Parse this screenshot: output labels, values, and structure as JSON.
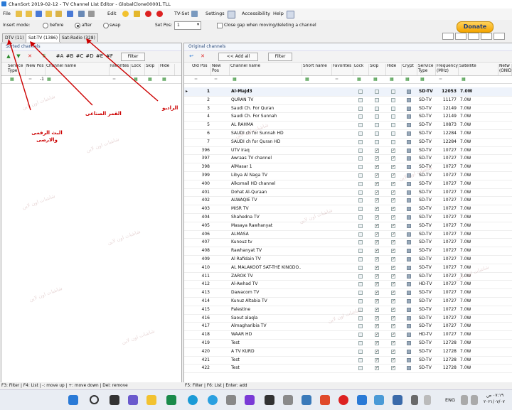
{
  "window": {
    "title": "ChanSort 2019-02-12 - TV Channel List Editor - GlobalClone00001.TLL"
  },
  "menu": {
    "file": "File",
    "edit": "Edit",
    "tvset": "TV-Set",
    "settings": "Settings",
    "accessibility": "Accessibility",
    "help": "Help"
  },
  "options": {
    "insert_mode": "Insert mode:",
    "before": "before",
    "after": "after",
    "swap": "swap",
    "set_pos_label": "Set Pos:",
    "set_pos_value": "1",
    "close_gap": "Close gap when moving/deleting a channel"
  },
  "donate": "Donate",
  "tabs": [
    {
      "label": "DTV (11)"
    },
    {
      "label": "Sat-TV (1386)"
    },
    {
      "label": "Sat-Radio (328)"
    }
  ],
  "left": {
    "title": "Sorted channels",
    "filter": "Filter",
    "btns": [
      "#A",
      "#B",
      "#C",
      "#D",
      "#E",
      "#F"
    ],
    "cols": [
      "Service Type",
      "New Pos",
      "Channel name",
      "Favorites",
      "Lock",
      "Skip",
      "Hide"
    ],
    "filter_pos": "-1"
  },
  "right": {
    "title": "Original channels",
    "add_all": "<< Add all",
    "filter": "Filter",
    "cols": [
      "Old Pos",
      "New Pos",
      "Channel name",
      "Short name",
      "Favorites",
      "Lock",
      "Skip",
      "Hide",
      "Crypt",
      "Service Type",
      "Frequency (MHz)",
      "Satellite",
      "Netw (ONID)"
    ],
    "rows": [
      {
        "old": "1",
        "name": "Al-Majd3",
        "skip": false,
        "hide": false,
        "svc": "SD-TV",
        "freq": "12053",
        "sat": "7.0W",
        "sel": true
      },
      {
        "old": "2",
        "name": "QURAN TV",
        "skip": false,
        "hide": false,
        "svc": "SD-TV",
        "freq": "11177",
        "sat": "7.0W"
      },
      {
        "old": "3",
        "name": "Saudi Ch. For Quran",
        "skip": false,
        "hide": false,
        "svc": "SD-TV",
        "freq": "12149",
        "sat": "7.0W"
      },
      {
        "old": "4",
        "name": "Saudi Ch. For Sunnah",
        "skip": false,
        "hide": false,
        "svc": "SD-TV",
        "freq": "12149",
        "sat": "7.0W"
      },
      {
        "old": "5",
        "name": "AL RAHMA",
        "skip": false,
        "hide": false,
        "svc": "SD-TV",
        "freq": "10873",
        "sat": "7.0W"
      },
      {
        "old": "6",
        "name": "SAUDI ch for Sunnah HD",
        "skip": false,
        "hide": false,
        "svc": "SD-TV",
        "freq": "12284",
        "sat": "7.0W"
      },
      {
        "old": "7",
        "name": "SAUDI ch for Quran HD",
        "skip": false,
        "hide": false,
        "svc": "SD-TV",
        "freq": "12284",
        "sat": "7.0W"
      },
      {
        "old": "396",
        "name": "UTV Iraq",
        "skip": true,
        "hide": true,
        "svc": "SD-TV",
        "freq": "10727",
        "sat": "7.0W"
      },
      {
        "old": "397",
        "name": "Awraas TV channel",
        "skip": true,
        "hide": true,
        "svc": "SD-TV",
        "freq": "10727",
        "sat": "7.0W"
      },
      {
        "old": "398",
        "name": "AlMasar 1",
        "skip": true,
        "hide": true,
        "svc": "SD-TV",
        "freq": "10727",
        "sat": "7.0W"
      },
      {
        "old": "399",
        "name": "Libya Al Naga TV",
        "skip": true,
        "hide": true,
        "svc": "SD-TV",
        "freq": "10727",
        "sat": "7.0W"
      },
      {
        "old": "400",
        "name": "Alkomail HD channel",
        "skip": true,
        "hide": true,
        "svc": "SD-TV",
        "freq": "10727",
        "sat": "7.0W"
      },
      {
        "old": "401",
        "name": "Dohat Al-Quraan",
        "skip": true,
        "hide": true,
        "svc": "SD-TV",
        "freq": "10727",
        "sat": "7.0W"
      },
      {
        "old": "402",
        "name": "ALWAQIE TV",
        "skip": true,
        "hide": true,
        "svc": "SD-TV",
        "freq": "10727",
        "sat": "7.0W"
      },
      {
        "old": "403",
        "name": "MISR TV",
        "skip": true,
        "hide": true,
        "svc": "SD-TV",
        "freq": "10727",
        "sat": "7.0W"
      },
      {
        "old": "404",
        "name": "Shahedna TV",
        "skip": true,
        "hide": true,
        "svc": "SD-TV",
        "freq": "10727",
        "sat": "7.0W"
      },
      {
        "old": "405",
        "name": "Masaya Rawhanyat",
        "skip": true,
        "hide": true,
        "svc": "SD-TV",
        "freq": "10727",
        "sat": "7.0W"
      },
      {
        "old": "406",
        "name": "ALMASA",
        "skip": true,
        "hide": true,
        "svc": "SD-TV",
        "freq": "10727",
        "sat": "7.0W"
      },
      {
        "old": "407",
        "name": "Kunouz tv",
        "skip": true,
        "hide": true,
        "svc": "SD-TV",
        "freq": "10727",
        "sat": "7.0W"
      },
      {
        "old": "408",
        "name": "Rawhanyat TV",
        "skip": true,
        "hide": true,
        "svc": "SD-TV",
        "freq": "10727",
        "sat": "7.0W"
      },
      {
        "old": "409",
        "name": "Al Rafidain TV",
        "skip": true,
        "hide": true,
        "svc": "SD-TV",
        "freq": "10727",
        "sat": "7.0W"
      },
      {
        "old": "410",
        "name": "AL MALAKOOT SAT-THE KINGDO...",
        "skip": true,
        "hide": true,
        "svc": "SD-TV",
        "freq": "10727",
        "sat": "7.0W"
      },
      {
        "old": "411",
        "name": "ZAROK TV",
        "skip": true,
        "hide": true,
        "svc": "SD-TV",
        "freq": "10727",
        "sat": "7.0W"
      },
      {
        "old": "412",
        "name": "Al-Awhad TV",
        "skip": true,
        "hide": true,
        "svc": "HD-TV",
        "freq": "10727",
        "sat": "7.0W"
      },
      {
        "old": "413",
        "name": "Dawacom TV",
        "skip": true,
        "hide": true,
        "svc": "SD-TV",
        "freq": "10727",
        "sat": "7.0W"
      },
      {
        "old": "414",
        "name": "Kunuz Altabia TV",
        "skip": true,
        "hide": true,
        "svc": "SD-TV",
        "freq": "10727",
        "sat": "7.0W"
      },
      {
        "old": "415",
        "name": "Palestine",
        "skip": true,
        "hide": true,
        "svc": "SD-TV",
        "freq": "10727",
        "sat": "7.0W"
      },
      {
        "old": "416",
        "name": "Saout alaqla",
        "skip": true,
        "hide": true,
        "svc": "SD-TV",
        "freq": "10727",
        "sat": "7.0W"
      },
      {
        "old": "417",
        "name": "Almagharibia TV",
        "skip": true,
        "hide": true,
        "svc": "SD-TV",
        "freq": "10727",
        "sat": "7.0W"
      },
      {
        "old": "418",
        "name": "WAAR HD",
        "skip": true,
        "hide": true,
        "svc": "HD-TV",
        "freq": "10727",
        "sat": "7.0W"
      },
      {
        "old": "419",
        "name": "Test",
        "skip": true,
        "hide": true,
        "svc": "SD-TV",
        "freq": "12728",
        "sat": "7.0W"
      },
      {
        "old": "420",
        "name": "A TV KURD",
        "skip": true,
        "hide": true,
        "svc": "SD-TV",
        "freq": "12728",
        "sat": "7.0W"
      },
      {
        "old": "421",
        "name": "Test",
        "skip": true,
        "hide": true,
        "svc": "SD-TV",
        "freq": "12728",
        "sat": "7.0W"
      },
      {
        "old": "422",
        "name": "Test",
        "skip": true,
        "hide": true,
        "svc": "SD-TV",
        "freq": "12728",
        "sat": "7.0W"
      }
    ]
  },
  "annotations": {
    "dtv": "البث الرقمى والارضى",
    "sat_tv": "القمر الصناعى",
    "radio": "الراديو"
  },
  "watermark": "شاشات اون لاين",
  "status": {
    "left": "F3: Filter | F4: List | -: move up | +: move down | Del: remove",
    "right": "F5: Filter | F6: List | Enter: add"
  },
  "taskbar": {
    "lang": "ENG",
    "time": "٠٧:١٩ ص",
    "date": "٢٠٢١/٠٧/٠٧"
  },
  "colors": {
    "accent": "#2a7ad6",
    "check": "#2b8a2b",
    "delete": "#d22",
    "annot": "#cc0000"
  }
}
